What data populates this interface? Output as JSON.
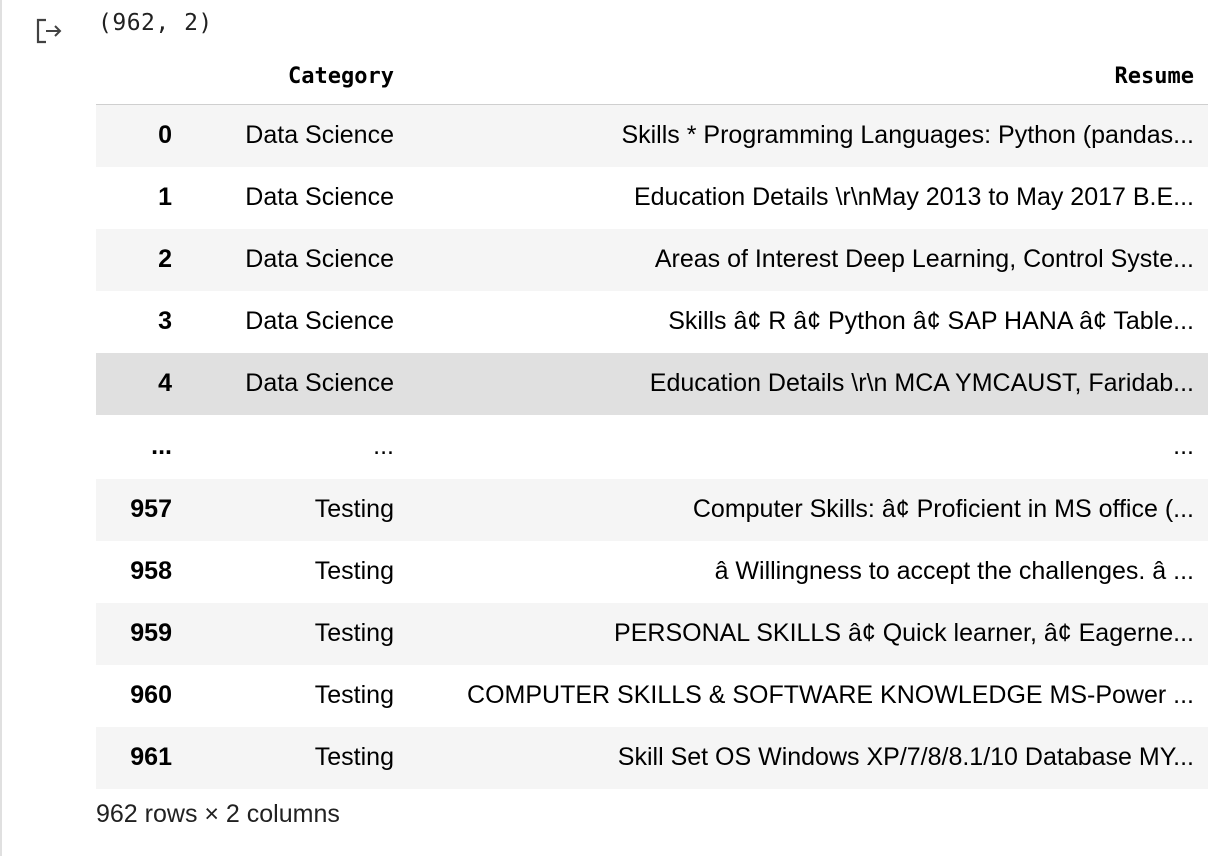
{
  "output": {
    "icon": "output-redirect-icon",
    "shape_text": "(962, 2)",
    "footer": "962 rows × 2 columns"
  },
  "table": {
    "columns": [
      "Category",
      "Resume"
    ],
    "rows": [
      {
        "index": "0",
        "category": "Data Science",
        "resume": "Skills * Programming Languages: Python (pandas..."
      },
      {
        "index": "1",
        "category": "Data Science",
        "resume": "Education Details \\r\\nMay 2013 to May 2017 B.E..."
      },
      {
        "index": "2",
        "category": "Data Science",
        "resume": "Areas of Interest Deep Learning, Control Syste..."
      },
      {
        "index": "3",
        "category": "Data Science",
        "resume": "Skills â¢ R â¢ Python â¢ SAP HANA â¢ Table..."
      },
      {
        "index": "4",
        "category": "Data Science",
        "resume": "Education Details \\r\\n MCA YMCAUST, Faridab..."
      },
      {
        "index": "...",
        "category": "...",
        "resume": "..."
      },
      {
        "index": "957",
        "category": "Testing",
        "resume": "Computer Skills: â¢ Proficient in MS office (..."
      },
      {
        "index": "958",
        "category": "Testing",
        "resume": "â Willingness to accept the challenges. â ..."
      },
      {
        "index": "959",
        "category": "Testing",
        "resume": "PERSONAL SKILLS â¢ Quick learner, â¢ Eagerne..."
      },
      {
        "index": "960",
        "category": "Testing",
        "resume": "COMPUTER SKILLS & SOFTWARE KNOWLEDGE MS-Power ..."
      },
      {
        "index": "961",
        "category": "Testing",
        "resume": "Skill Set OS Windows XP/7/8/8.1/10 Database MY..."
      }
    ]
  },
  "colors": {
    "row_stripe": "#f5f5f5",
    "row_hover": "#e0e0e0",
    "header_border": "#cfcfcf"
  }
}
